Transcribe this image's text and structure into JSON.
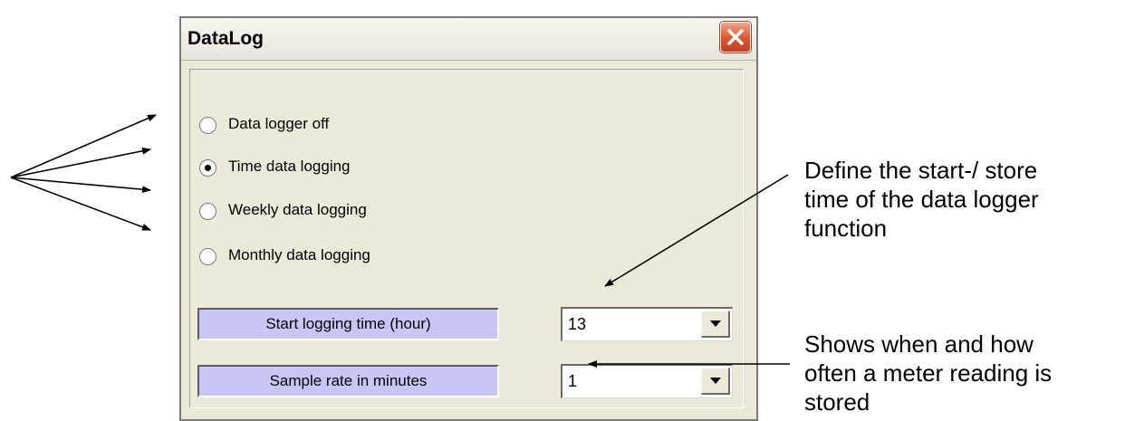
{
  "window": {
    "title": "DataLog"
  },
  "radio_options": [
    {
      "label": "Data logger off",
      "selected": false
    },
    {
      "label": "Time data logging",
      "selected": true
    },
    {
      "label": "Weekly data logging",
      "selected": false
    },
    {
      "label": "Monthly data logging",
      "selected": false
    }
  ],
  "fields": {
    "start_time": {
      "label": "Start logging time (hour)",
      "value": "13"
    },
    "sample_rate": {
      "label": "Sample rate in minutes",
      "value": "1"
    }
  },
  "annotations": {
    "start_time_line1": "Define the start-/ store",
    "start_time_line2": "time of the data logger",
    "start_time_line3": "function",
    "sample_rate_line1": "Shows when and how",
    "sample_rate_line2": "often a meter reading is",
    "sample_rate_line3": "stored"
  },
  "colors": {
    "dialog_bg": "#ece9d8",
    "label_bg": "#c8c6f7",
    "close_button": "#d9552f"
  }
}
